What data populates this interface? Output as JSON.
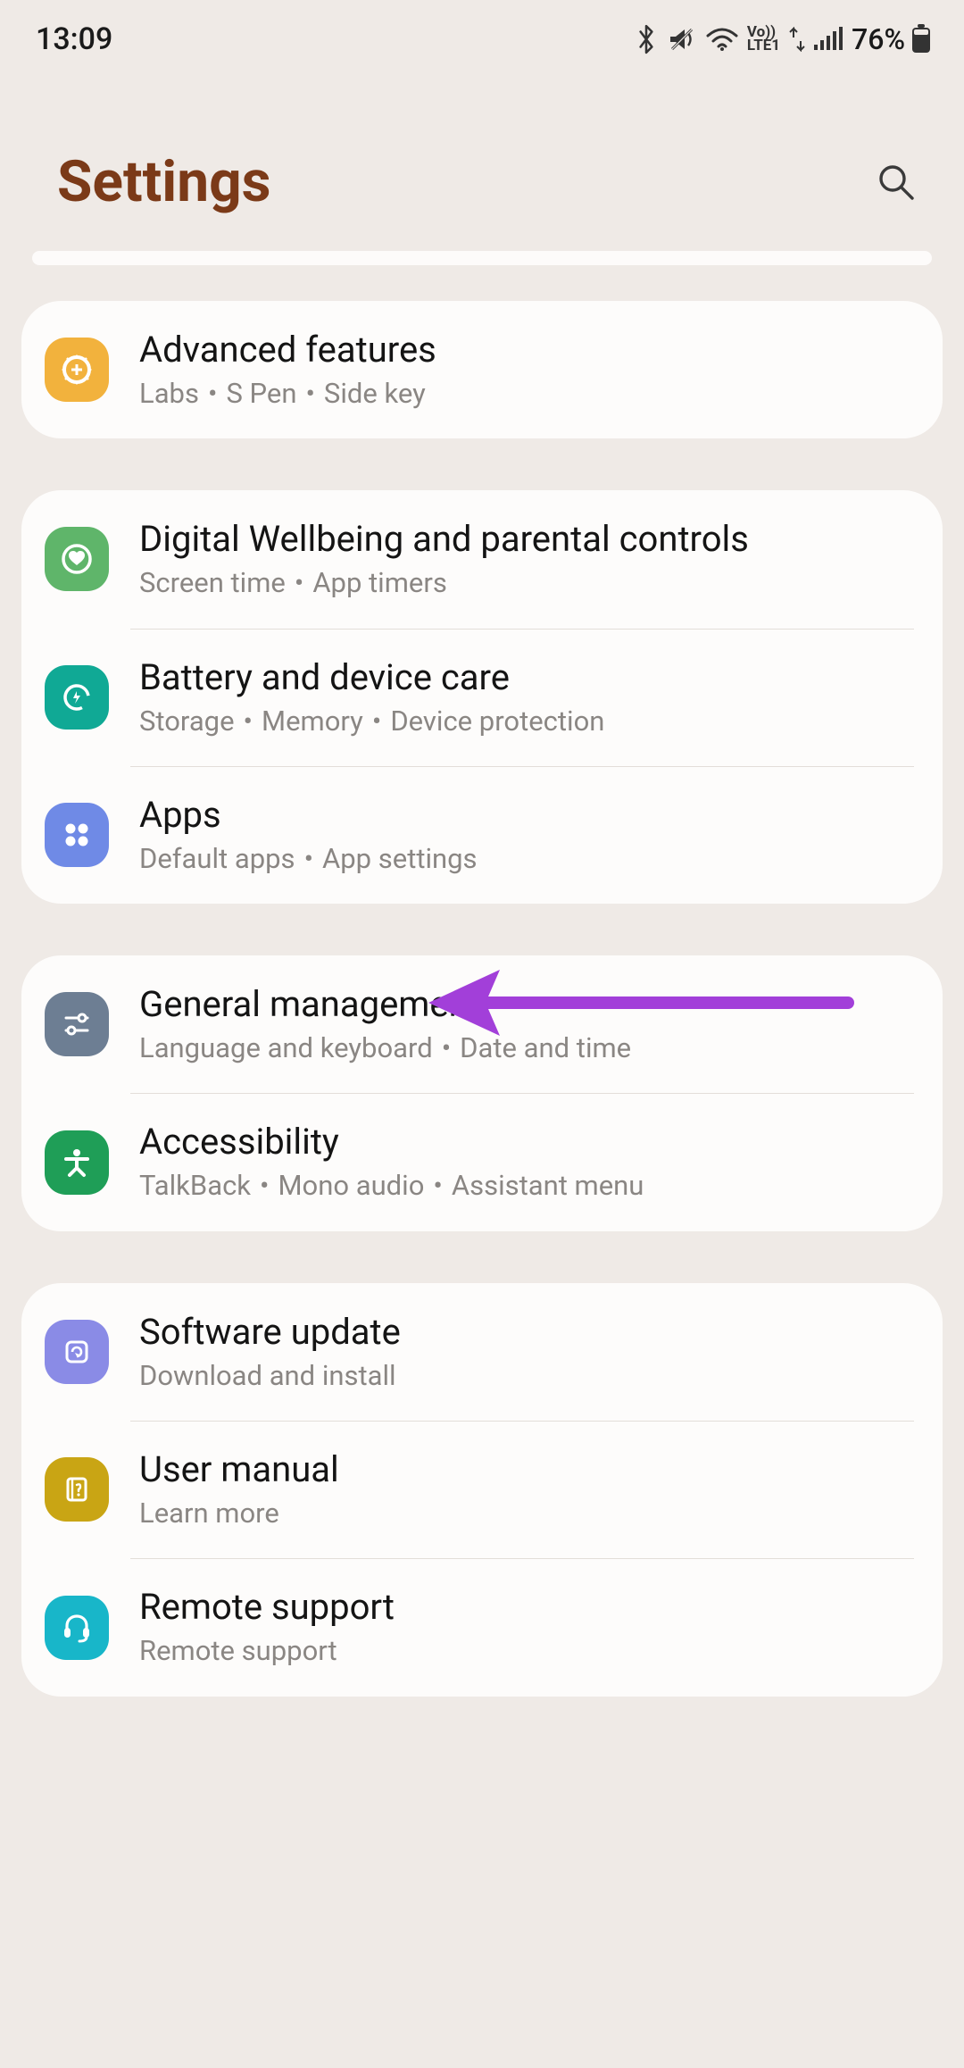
{
  "status": {
    "time": "13:09",
    "battery_pct": "76%"
  },
  "header": {
    "title": "Settings"
  },
  "groups": [
    {
      "items": [
        {
          "id": "advanced",
          "title": "Advanced features",
          "sub": [
            "Labs",
            "S Pen",
            "Side key"
          ],
          "color": "#f2b23d"
        }
      ]
    },
    {
      "items": [
        {
          "id": "wellbeing",
          "title": "Digital Wellbeing and parental controls",
          "sub": [
            "Screen time",
            "App timers"
          ],
          "color": "#5fb56a"
        },
        {
          "id": "battery",
          "title": "Battery and device care",
          "sub": [
            "Storage",
            "Memory",
            "Device protection"
          ],
          "color": "#10a995"
        },
        {
          "id": "apps",
          "title": "Apps",
          "sub": [
            "Default apps",
            "App settings"
          ],
          "color": "#6f8ae6"
        }
      ]
    },
    {
      "items": [
        {
          "id": "general",
          "title": "General management",
          "sub": [
            "Language and keyboard",
            "Date and time"
          ],
          "color": "#6d7e93"
        },
        {
          "id": "accessibility",
          "title": "Accessibility",
          "sub": [
            "TalkBack",
            "Mono audio",
            "Assistant menu"
          ],
          "color": "#1f9e57"
        }
      ]
    },
    {
      "items": [
        {
          "id": "software",
          "title": "Software update",
          "sub": [
            "Download and install"
          ],
          "color": "#8a8be6"
        },
        {
          "id": "manual",
          "title": "User manual",
          "sub": [
            "Learn more"
          ],
          "color": "#c9a514"
        },
        {
          "id": "remote",
          "title": "Remote support",
          "sub": [
            "Remote support"
          ],
          "color": "#18b6c9"
        }
      ]
    }
  ]
}
